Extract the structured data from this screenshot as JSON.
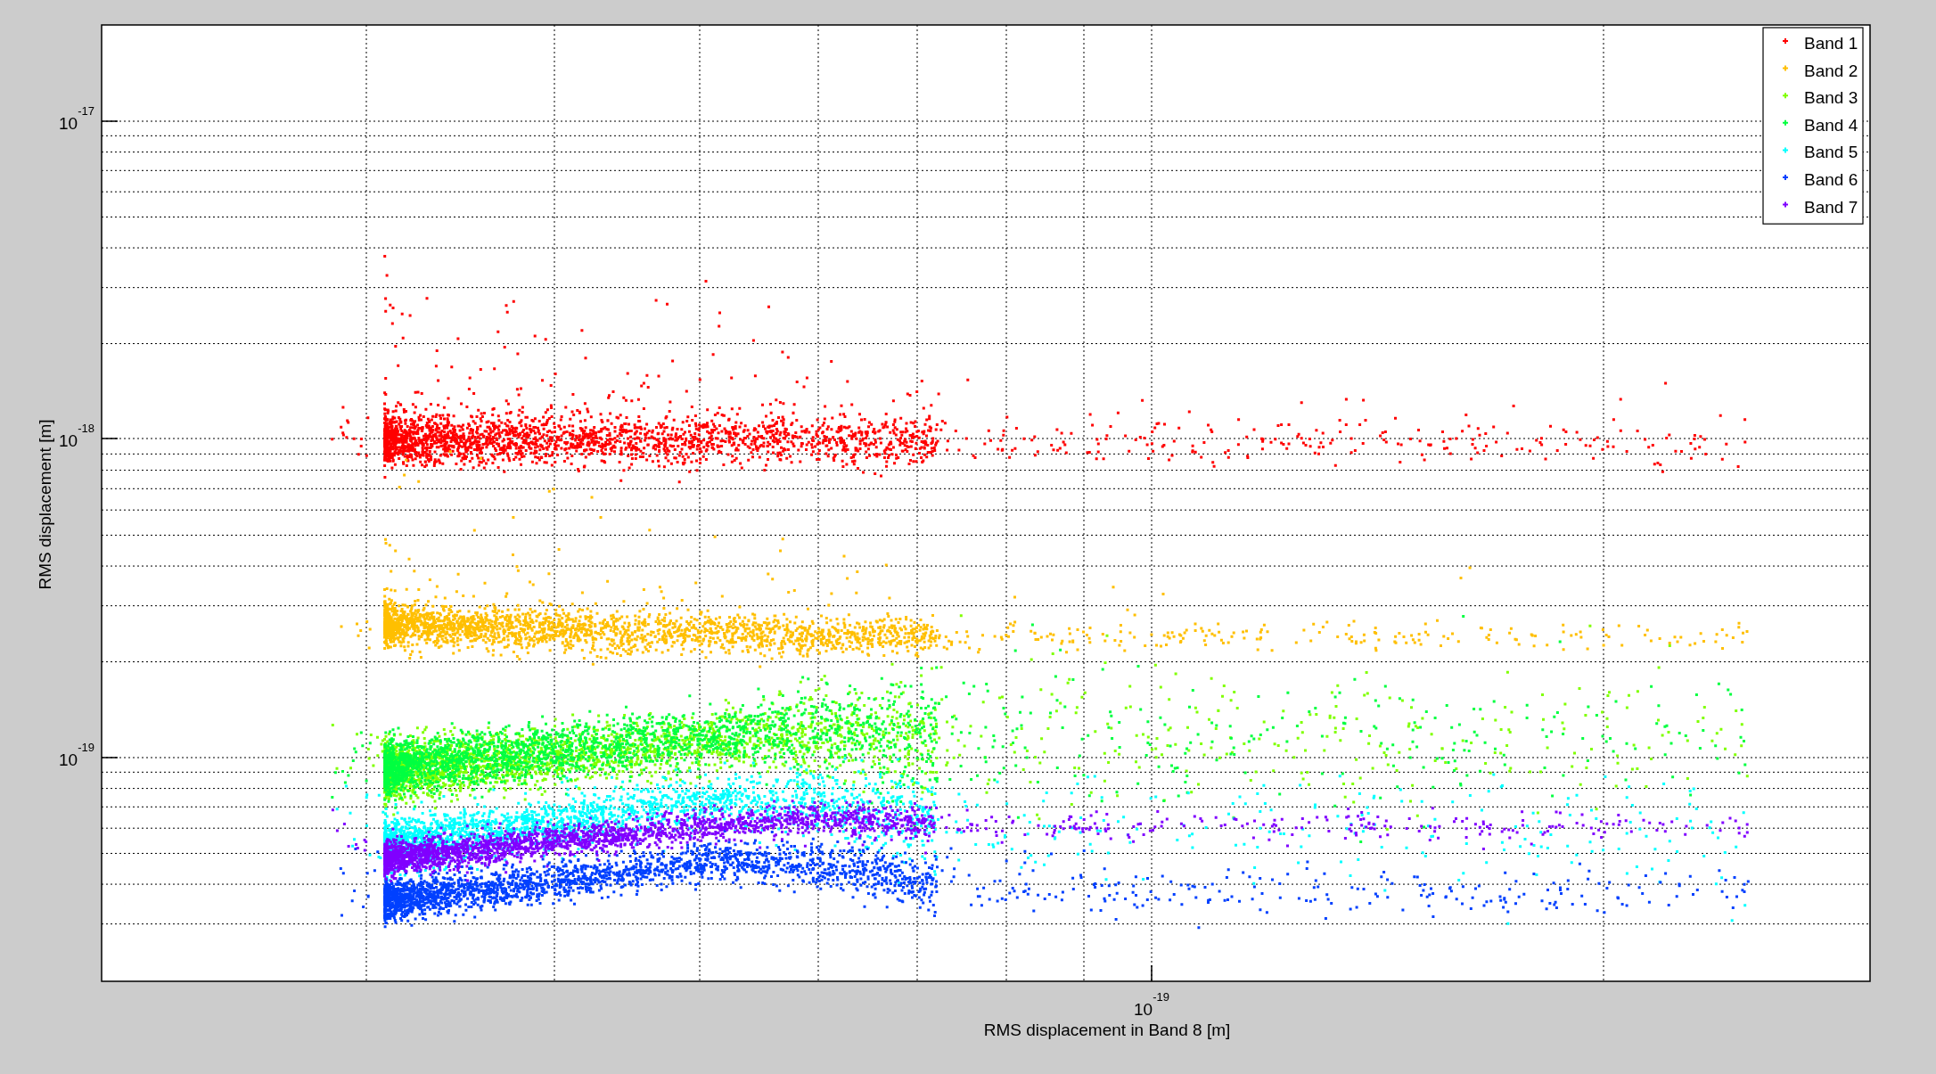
{
  "chart": {
    "xlabel": "RMS displacement in Band 8 [m]",
    "ylabel": "RMS displacement [m]",
    "x_tick_labels": [
      {
        "base": "10",
        "exponent": "-19"
      }
    ],
    "y_tick_labels": [
      {
        "base": "10",
        "exponent": "-17"
      },
      {
        "base": "10",
        "exponent": "-18"
      },
      {
        "base": "10",
        "exponent": "-19"
      }
    ],
    "legend": [
      {
        "label": "Band 1",
        "color": "#ff0000"
      },
      {
        "label": "Band 2",
        "color": "#ffbf00"
      },
      {
        "label": "Band 3",
        "color": "#80ff00"
      },
      {
        "label": "Band 4",
        "color": "#00ff40"
      },
      {
        "label": "Band 5",
        "color": "#00ffff"
      },
      {
        "label": "Band 6",
        "color": "#0040ff"
      },
      {
        "label": "Band 7",
        "color": "#8000ff"
      }
    ]
  }
}
